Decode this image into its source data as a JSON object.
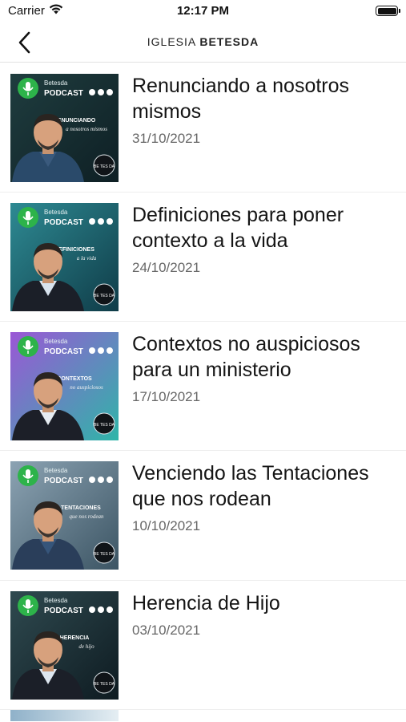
{
  "status_bar": {
    "carrier": "Carrier",
    "time": "12:17 PM"
  },
  "nav": {
    "title_light": "IGLESIA",
    "title_bold": "BETESDA"
  },
  "episodes": [
    {
      "title": "Renunciando a nosotros mismos",
      "date": "31/10/2021",
      "thumb": {
        "bg1": "#1f3d3f",
        "bg2": "#0e1f24",
        "jacket": "#2a4a6a",
        "shirt": "#3a5a7d",
        "overlay": "RENUNCIANDO",
        "overlay2": "a nosotros mismos"
      }
    },
    {
      "title": "Definiciones para poner contexto a la vida",
      "date": "24/10/2021",
      "thumb": {
        "bg1": "#2e8a93",
        "bg2": "#0f3c48",
        "jacket": "#1b1f28",
        "shirt": "#d8e3ee",
        "overlay": "DEFINICIONES",
        "overlay2": "a la vida"
      }
    },
    {
      "title": "Contextos no auspiciosos para un ministerio",
      "date": "17/10/2021",
      "thumb": {
        "bg1": "#9b57d6",
        "bg2": "#2fb5a8",
        "jacket": "#1c1f28",
        "shirt": "#e6ecf2",
        "overlay": "CONTEXTOS",
        "overlay2": "no auspiciosos"
      }
    },
    {
      "title": "Venciendo las Tentaciones que nos rodean",
      "date": "10/10/2021",
      "thumb": {
        "bg1": "#8ca3b3",
        "bg2": "#3c5564",
        "jacket": "#2a3e5a",
        "shirt": "#36557a",
        "overlay": "LAS TENTACIONES",
        "overlay2": "que nos rodean"
      }
    },
    {
      "title": "Herencia de Hijo",
      "date": "03/10/2021",
      "thumb": {
        "bg1": "#2f4a50",
        "bg2": "#0e1b21",
        "jacket": "#1b1f28",
        "shirt": "#dde6ef",
        "overlay": "HERENCIA",
        "overlay2": "de hijo"
      }
    }
  ],
  "podcast_badge": {
    "line1": "Betesda",
    "line2": "PODCAST",
    "seal": "BE TES DA"
  }
}
